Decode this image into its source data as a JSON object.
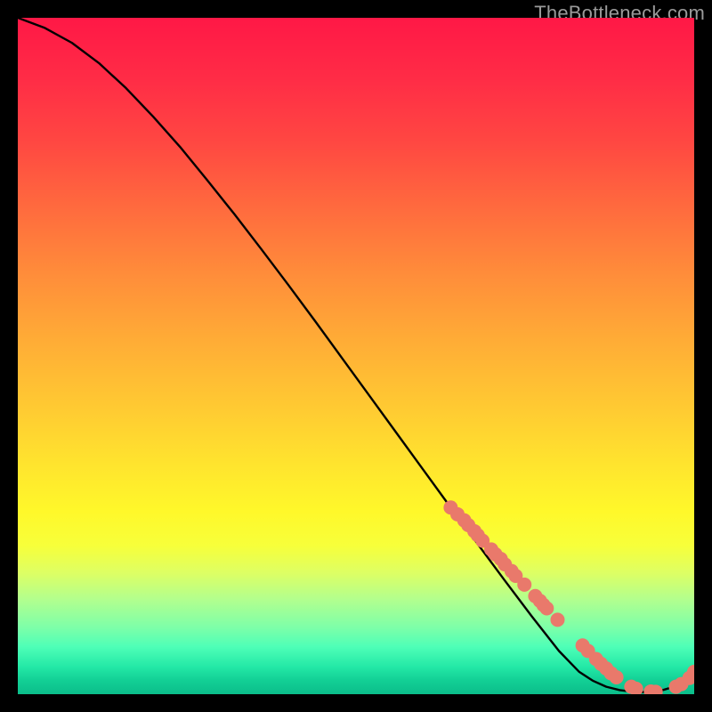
{
  "attribution": "TheBottleneck.com",
  "colors": {
    "curve": "#000000",
    "marker_fill": "#e9796b",
    "marker_stroke": "#c15f53"
  },
  "chart_data": {
    "type": "line",
    "title": "",
    "xlabel": "",
    "ylabel": "",
    "xlim": [
      0,
      100
    ],
    "ylim": [
      0,
      100
    ],
    "grid": false,
    "legend": false,
    "series": [
      {
        "name": "bottleneck-curve",
        "x": [
          0,
          4,
          8,
          12,
          16,
          20,
          24,
          28,
          32,
          36,
          40,
          44,
          48,
          52,
          56,
          60,
          64,
          68,
          72,
          76,
          80,
          83,
          85,
          87,
          89,
          91,
          93,
          95,
          97,
          99,
          100
        ],
        "y": [
          100,
          98.5,
          96.3,
          93.3,
          89.6,
          85.4,
          80.9,
          76.0,
          71.0,
          65.8,
          60.5,
          55.1,
          49.6,
          44.1,
          38.6,
          33.1,
          27.6,
          22.2,
          16.8,
          11.5,
          6.4,
          3.3,
          2.0,
          1.1,
          0.6,
          0.35,
          0.3,
          0.5,
          1.1,
          2.2,
          3.3
        ]
      }
    ],
    "markers": {
      "name": "data-points",
      "x": [
        64,
        65,
        66,
        66.6,
        67.5,
        68,
        68.7,
        70,
        70.6,
        71.4,
        72,
        73,
        73.6,
        74.9,
        76.5,
        77.2,
        77.7,
        78.2,
        79.8,
        83.5,
        84.3,
        85.5,
        86.2,
        87,
        87.7,
        88.5,
        90.7,
        91.4,
        93.6,
        94.3,
        97.3,
        98.1,
        99.3,
        100
      ],
      "y": [
        27.6,
        26.6,
        25.7,
        25.0,
        24.1,
        23.5,
        22.7,
        21.4,
        20.7,
        20.0,
        19.2,
        18.2,
        17.5,
        16.2,
        14.5,
        13.8,
        13.2,
        12.7,
        11.0,
        7.2,
        6.4,
        5.2,
        4.5,
        3.8,
        3.1,
        2.5,
        1.1,
        0.8,
        0.4,
        0.35,
        1.1,
        1.5,
        2.4,
        3.3
      ],
      "radius": 8
    }
  }
}
